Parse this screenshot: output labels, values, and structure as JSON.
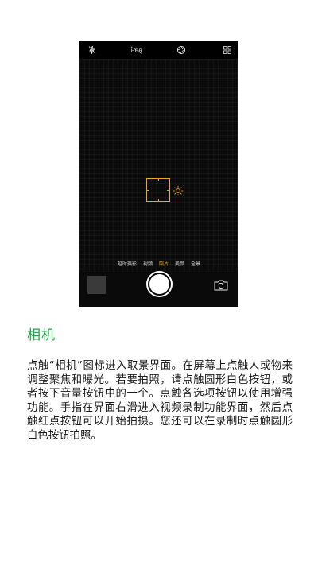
{
  "camera": {
    "top_icons": [
      "flash-off-icon",
      "hdr-icon",
      "aperture-filter-icon",
      "grid-menu-icon"
    ],
    "hdr_label": "HDR",
    "modes": [
      {
        "label": "延时摄影",
        "active": false
      },
      {
        "label": "视频",
        "active": false
      },
      {
        "label": "照片",
        "active": true
      },
      {
        "label": "美颜",
        "active": false
      },
      {
        "label": "全景",
        "active": false
      }
    ],
    "accent_color": "#f0a61a"
  },
  "section": {
    "title": "相机",
    "title_color": "#2aa546",
    "body": "点触“相机”图标进入取景界面。在屏幕上点触人或物来调整聚焦和曝光。若要拍照，请点触圆形白色按钮，或者按下音量按钮中的一个。点触各选项按钮以使用增强功能。手指在界面右滑进入视频录制功能界面，然后点触红点按钮可以开始拍摄。您还可以在录制时点触圆形白色按钮拍照。"
  }
}
